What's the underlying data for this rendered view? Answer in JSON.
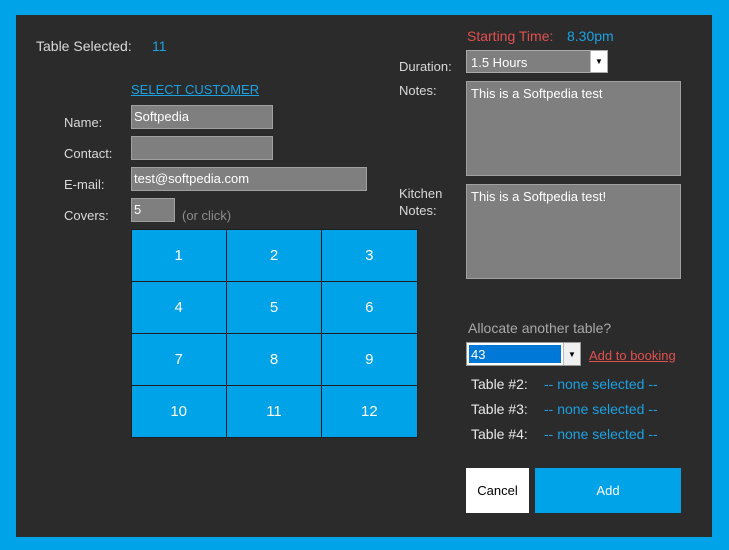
{
  "left": {
    "table_selected_label": "Table Selected:",
    "table_selected_value": "11",
    "select_customer_link": "SELECT CUSTOMER",
    "name_label": "Name:",
    "name_value": "Softpedia",
    "contact_label": "Contact:",
    "contact_value": "",
    "email_label": "E-mail:",
    "email_value": "test@softpedia.com",
    "covers_label": "Covers:",
    "covers_value": "5",
    "covers_hint": "(or click)",
    "numpad": [
      "1",
      "2",
      "3",
      "4",
      "5",
      "6",
      "7",
      "8",
      "9",
      "10",
      "11",
      "12"
    ]
  },
  "right": {
    "starting_time_label": "Starting Time:",
    "starting_time_value": "8.30pm",
    "duration_label": "Duration:",
    "duration_value": "1.5 Hours",
    "notes_label": "Notes:",
    "notes_value": "This is a Softpedia test",
    "kitchen_label_1": "Kitchen",
    "kitchen_label_2": "Notes:",
    "kitchen_value": "This is a Softpedia test!",
    "allocate_label": "Allocate another table?",
    "allocate_value": "43",
    "add_to_booking": "Add to booking",
    "tables": [
      {
        "label": "Table #2:",
        "value": "-- none selected --"
      },
      {
        "label": "Table #3:",
        "value": "-- none selected --"
      },
      {
        "label": "Table #4:",
        "value": "-- none selected --"
      }
    ],
    "cancel_label": "Cancel",
    "add_label": "Add"
  },
  "colors": {
    "accent": "#00a2e8",
    "panel": "#2b2b2b",
    "red": "#e05050",
    "link_blue": "#1ba1e2"
  }
}
